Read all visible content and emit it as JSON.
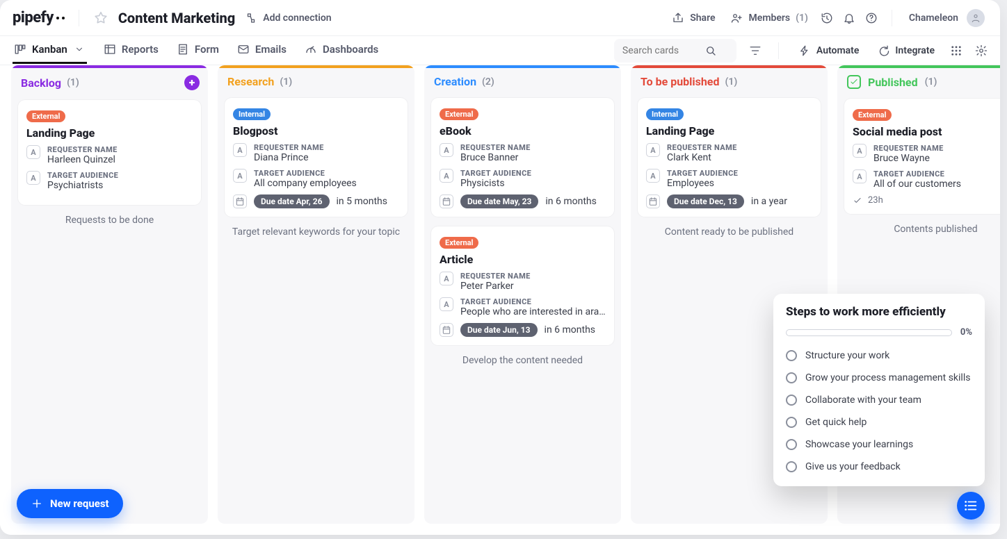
{
  "brand": "pipefy",
  "pipe_title": "Content Marketing",
  "add_connection": "Add connection",
  "header": {
    "share": "Share",
    "members_label": "Members",
    "members_count": "(1)",
    "user_name": "Chameleon"
  },
  "tabs": {
    "kanban": "Kanban",
    "reports": "Reports",
    "form": "Form",
    "emails": "Emails",
    "dashboards": "Dashboards"
  },
  "tools": {
    "search_placeholder": "Search cards",
    "automate": "Automate",
    "integrate": "Integrate"
  },
  "columns": [
    {
      "id": "backlog",
      "color": "#8a2be2",
      "title": "Backlog",
      "count": "(1)",
      "footer": "Requests to be done",
      "show_add": true,
      "cards": [
        {
          "badge": {
            "text": "External",
            "style": "external"
          },
          "title": "Landing Page",
          "requester_label": "REQUESTER NAME",
          "requester": "Harleen Quinzel",
          "audience_label": "TARGET AUDIENCE",
          "audience": "Psychiatrists"
        }
      ]
    },
    {
      "id": "research",
      "color": "#f2a11f",
      "title": "Research",
      "count": "(1)",
      "footer": "Target relevant keywords for your topic",
      "cards": [
        {
          "badge": {
            "text": "Internal",
            "style": "internal"
          },
          "title": "Blogpost",
          "requester_label": "REQUESTER NAME",
          "requester": "Diana Prince",
          "audience_label": "TARGET AUDIENCE",
          "audience": "All company employees",
          "due_pill": "Due date Apr, 26",
          "due_rel": "in 5 months"
        }
      ]
    },
    {
      "id": "creation",
      "color": "#2d8cff",
      "title": "Creation",
      "count": "(2)",
      "footer": "Develop the content needed",
      "cards": [
        {
          "badge": {
            "text": "External",
            "style": "external"
          },
          "title": "eBook",
          "requester_label": "REQUESTER NAME",
          "requester": "Bruce Banner",
          "audience_label": "TARGET AUDIENCE",
          "audience": "Physicists",
          "due_pill": "Due date May, 23",
          "due_rel": "in 6 months"
        },
        {
          "badge": {
            "text": "External",
            "style": "external"
          },
          "title": "Article",
          "requester_label": "REQUESTER NAME",
          "requester": "Peter Parker",
          "audience_label": "TARGET AUDIENCE",
          "audience": "People who are interested in arach…",
          "due_pill": "Due date Jun, 13",
          "due_rel": "in 6 months"
        }
      ]
    },
    {
      "id": "tobepublished",
      "color": "#e34a3a",
      "title": "To be published",
      "count": "(1)",
      "footer": "Content ready to be published",
      "cards": [
        {
          "badge": {
            "text": "Internal",
            "style": "internal"
          },
          "title": "Landing Page",
          "requester_label": "REQUESTER NAME",
          "requester": "Clark Kent",
          "audience_label": "TARGET AUDIENCE",
          "audience": "Employees",
          "due_pill": "Due date Dec, 13",
          "due_rel": "in a year"
        }
      ]
    },
    {
      "id": "published",
      "color": "#43c65b",
      "done": true,
      "title": "Published",
      "count": "(1)",
      "footer": "Contents published",
      "cards": [
        {
          "badge": {
            "text": "External",
            "style": "external"
          },
          "title": "Social media post",
          "requester_label": "REQUESTER NAME",
          "requester": "Bruce Wayne",
          "audience_label": "TARGET AUDIENCE",
          "audience": "All of our customers",
          "done_label": "23h"
        }
      ]
    }
  ],
  "new_request": "New request",
  "tips": {
    "title": "Steps to work more efficiently",
    "percent": "0%",
    "items": [
      "Structure your work",
      "Grow your process management skills",
      "Collaborate with your team",
      "Get quick help",
      "Showcase your learnings",
      "Give us your feedback"
    ]
  }
}
